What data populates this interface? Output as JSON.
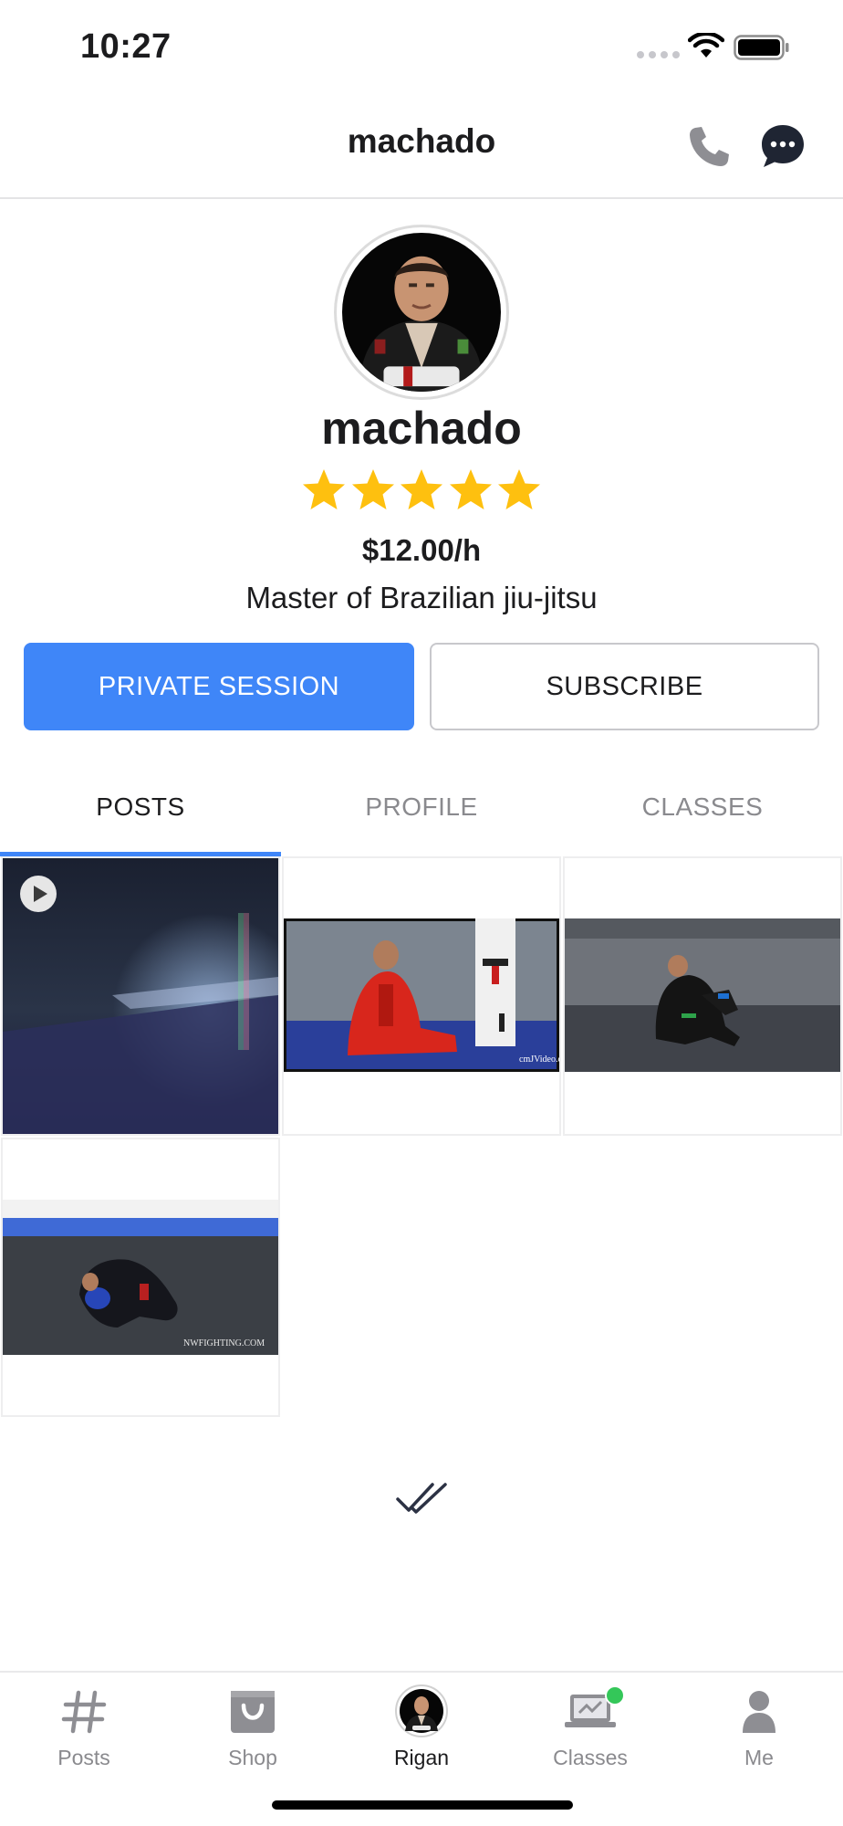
{
  "status_bar": {
    "time": "10:27"
  },
  "nav": {
    "title": "machado",
    "phone_icon": "phone-icon",
    "chat_icon": "chat-bubble-icon"
  },
  "profile": {
    "name": "machado",
    "rating": 5,
    "rating_max": 5,
    "price": "$12.00/h",
    "headline": "Master of Brazilian jiu-jitsu"
  },
  "actions": {
    "private_session_label": "PRIVATE SESSION",
    "subscribe_label": "SUBSCRIBE"
  },
  "tabs": [
    {
      "label": "POSTS",
      "active": true
    },
    {
      "label": "PROFILE",
      "active": false
    },
    {
      "label": "CLASSES",
      "active": false
    }
  ],
  "posts": [
    {
      "type": "video",
      "icon": "play-icon",
      "thumbnail_text": ""
    },
    {
      "type": "image",
      "thumbnail_text": "cmJVideo.com"
    },
    {
      "type": "image",
      "thumbnail_text": ""
    },
    {
      "type": "image",
      "thumbnail_text": "NWFIGHTING.COM"
    }
  ],
  "end_of_list_icon": "double-check-icon",
  "tabbar": [
    {
      "label": "Posts",
      "icon": "hash-icon",
      "active": false
    },
    {
      "label": "Shop",
      "icon": "shopping-bag-icon",
      "active": false
    },
    {
      "label": "Rigan",
      "icon": "avatar-icon",
      "active": true
    },
    {
      "label": "Classes",
      "icon": "laptop-icon",
      "active": false,
      "badge": true
    },
    {
      "label": "Me",
      "icon": "person-icon",
      "active": false
    }
  ],
  "colors": {
    "accent": "#3f86f8",
    "star": "#fec00f",
    "badge": "#34c759",
    "chat_icon": "#1f2533"
  }
}
